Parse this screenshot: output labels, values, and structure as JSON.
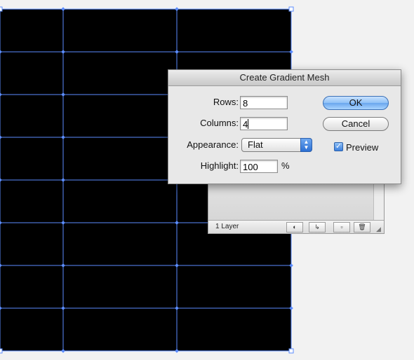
{
  "dialog": {
    "title": "Create Gradient Mesh",
    "rows_label": "Rows:",
    "rows_value": "8",
    "columns_label": "Columns:",
    "columns_value": "4",
    "appearance_label": "Appearance:",
    "appearance_value": "Flat",
    "highlight_label": "Highlight:",
    "highlight_value": "100",
    "highlight_unit": "%",
    "ok_label": "OK",
    "cancel_label": "Cancel",
    "preview_label": "Preview",
    "preview_checked": true
  },
  "layers_panel": {
    "layer_count": "1 Layer"
  },
  "mesh": {
    "rows": 8,
    "columns": 4,
    "fill_color": "#000000",
    "line_color": "#5b8cff",
    "canvas_color": "#f2f2f2"
  }
}
